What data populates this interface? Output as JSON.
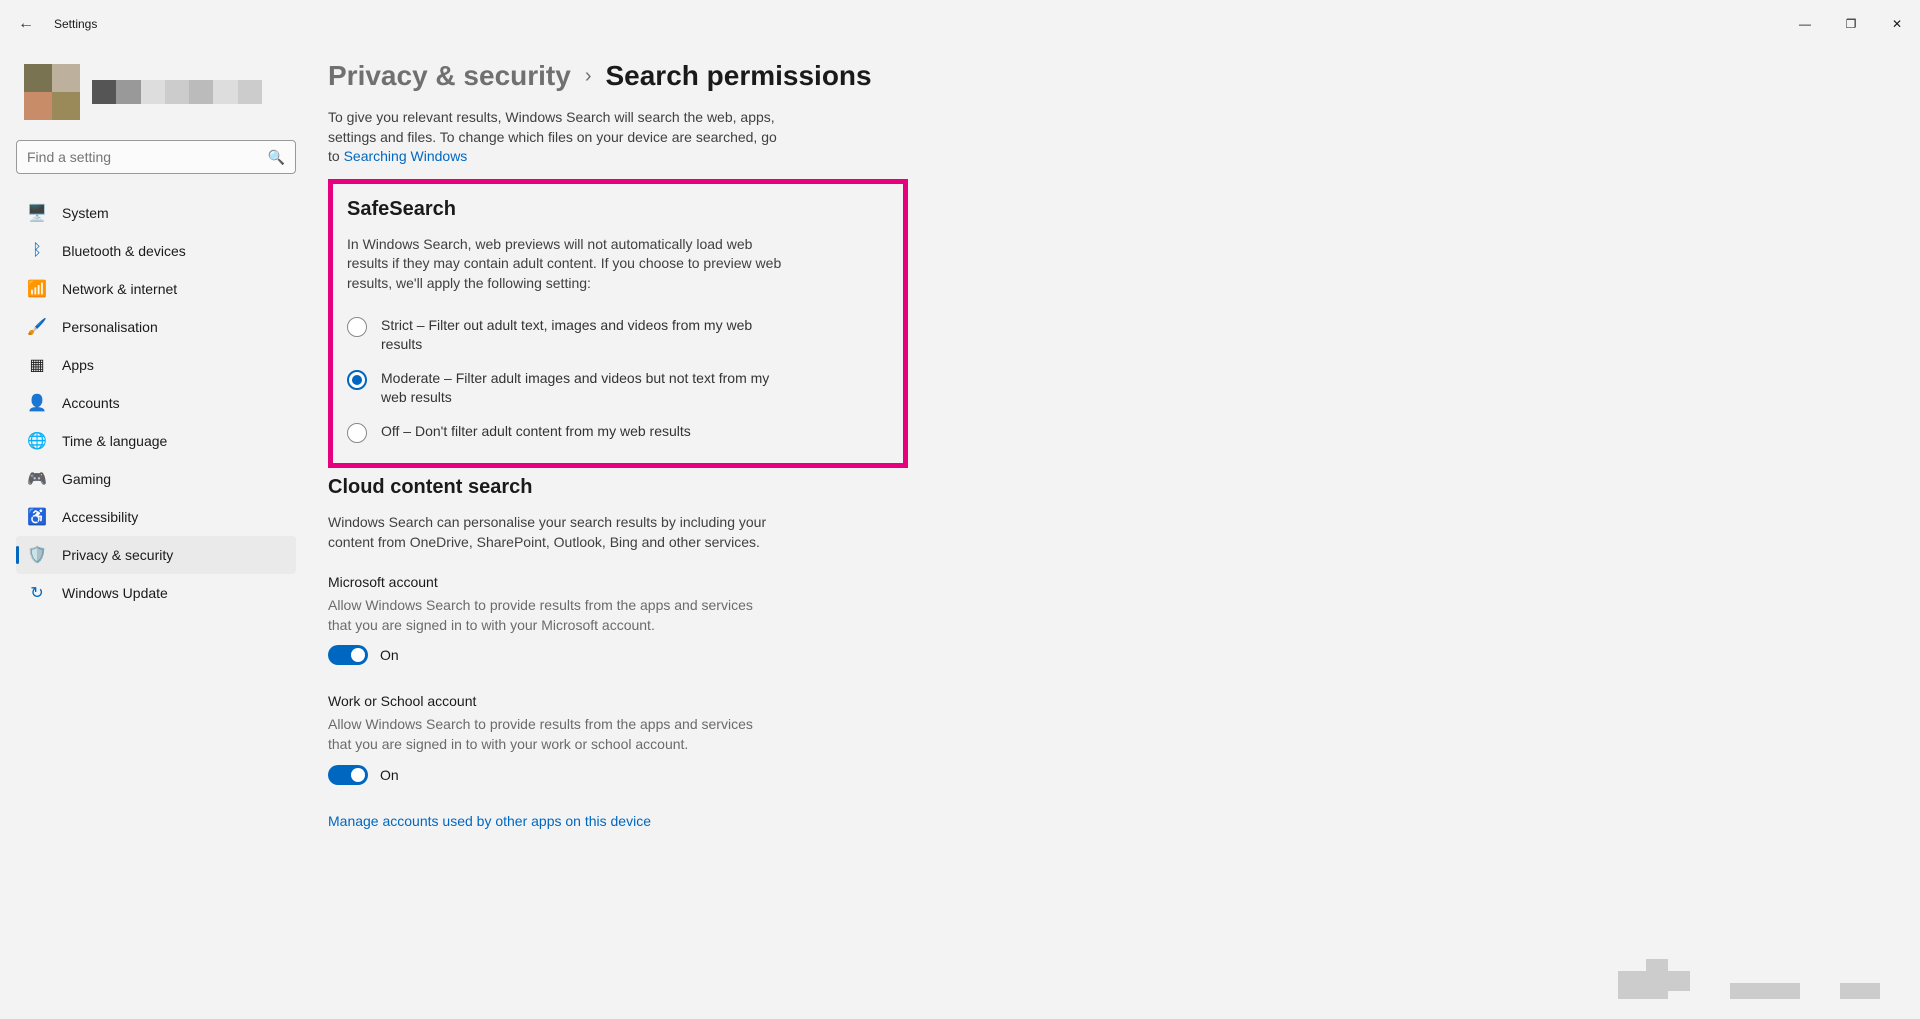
{
  "title": "Settings",
  "search": {
    "placeholder": "Find a setting"
  },
  "nav": [
    {
      "label": "System"
    },
    {
      "label": "Bluetooth & devices"
    },
    {
      "label": "Network & internet"
    },
    {
      "label": "Personalisation"
    },
    {
      "label": "Apps"
    },
    {
      "label": "Accounts"
    },
    {
      "label": "Time & language"
    },
    {
      "label": "Gaming"
    },
    {
      "label": "Accessibility"
    },
    {
      "label": "Privacy & security"
    },
    {
      "label": "Windows Update"
    }
  ],
  "breadcrumb": {
    "parent": "Privacy & security",
    "sep": "›",
    "current": "Search permissions"
  },
  "intro": {
    "text": "To give you relevant results, Windows Search will search the web, apps, settings and files. To change which files on your device are searched, go to ",
    "link": "Searching Windows"
  },
  "safesearch": {
    "heading": "SafeSearch",
    "desc": "In Windows Search, web previews will not automatically load web results if they may contain adult content. If you choose to preview web results, we'll apply the following setting:",
    "options": {
      "strict": "Strict – Filter out adult text, images and videos from my web results",
      "moderate": "Moderate – Filter adult images and videos but not text from my web results",
      "off": "Off – Don't filter adult content from my web results"
    }
  },
  "cloud": {
    "heading": "Cloud content search",
    "desc": "Windows Search can personalise your search results by including your content from OneDrive, SharePoint, Outlook, Bing and other services.",
    "ms": {
      "title": "Microsoft account",
      "desc": "Allow Windows Search to provide results from the apps and services that you are signed in to with your Microsoft account.",
      "state": "On"
    },
    "work": {
      "title": "Work or School account",
      "desc": "Allow Windows Search to provide results from the apps and services that you are signed in to with your work or school account.",
      "state": "On"
    },
    "manage_link": "Manage accounts used by other apps on this device"
  }
}
